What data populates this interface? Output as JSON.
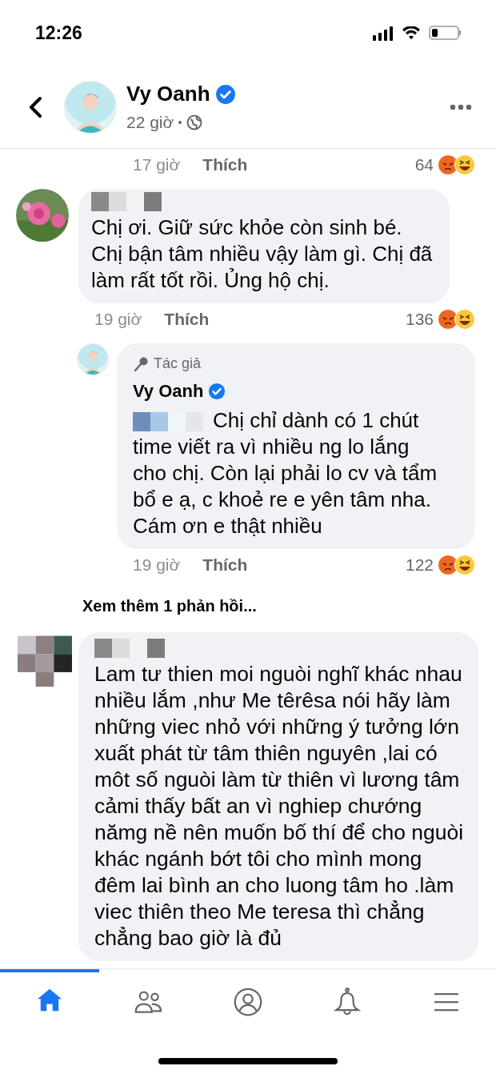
{
  "status_bar": {
    "time": "12:26"
  },
  "header": {
    "name": "Vy Oanh",
    "verified": true,
    "time": "22 giờ"
  },
  "top_meta": {
    "time": "17 giờ",
    "like": "Thích",
    "reaction_count": "64"
  },
  "comments": [
    {
      "author_redacted": true,
      "text": "Chị ơi. Giữ sức khỏe còn sinh bé. Chị bận tâm nhiều vậy làm gì. Chị đã làm rất tốt rồi. Ủng hộ chị.",
      "time": "19 giờ",
      "like": "Thích",
      "reaction_count": "136",
      "replies": [
        {
          "badge": "Tác giả",
          "author": "Vy Oanh",
          "verified": true,
          "mention_redacted": true,
          "text": "Chị chỉ dành có 1 chút time viết ra vì nhiều ng lo lắng cho chị. Còn lại phải lo cv và tẩm bổ e ạ, c khoẻ re e yên tâm nha. Cám ơn e thật nhiều",
          "time": "19 giờ",
          "like": "Thích",
          "reaction_count": "122"
        }
      ],
      "more_replies": "Xem thêm 1 phản hồi..."
    },
    {
      "author_redacted": true,
      "text": "Lam tư thien moi nguòi nghĩ khác nhau nhiều lắm ,như Me têrêsa nói hãy làm những viec nhỏ với những ý tưởng lớn xuất phát từ tâm thiên nguyên ,lai có môt số nguòi làm từ thiên vì lương tâm cảmi thấy bất an vì nghiep chướng nămg nề nên muốn bố thí để cho nguòi khác ngánh bớt tôi cho mình mong đêm lai bình an cho luong tâm ho .làm viec thiên theo Me teresa thì chẳng chẳng bao giờ là đủ"
    }
  ],
  "nav": [
    {
      "selected": true
    },
    {
      "selected": false
    },
    {
      "selected": false
    },
    {
      "selected": false
    },
    {
      "selected": false
    }
  ]
}
